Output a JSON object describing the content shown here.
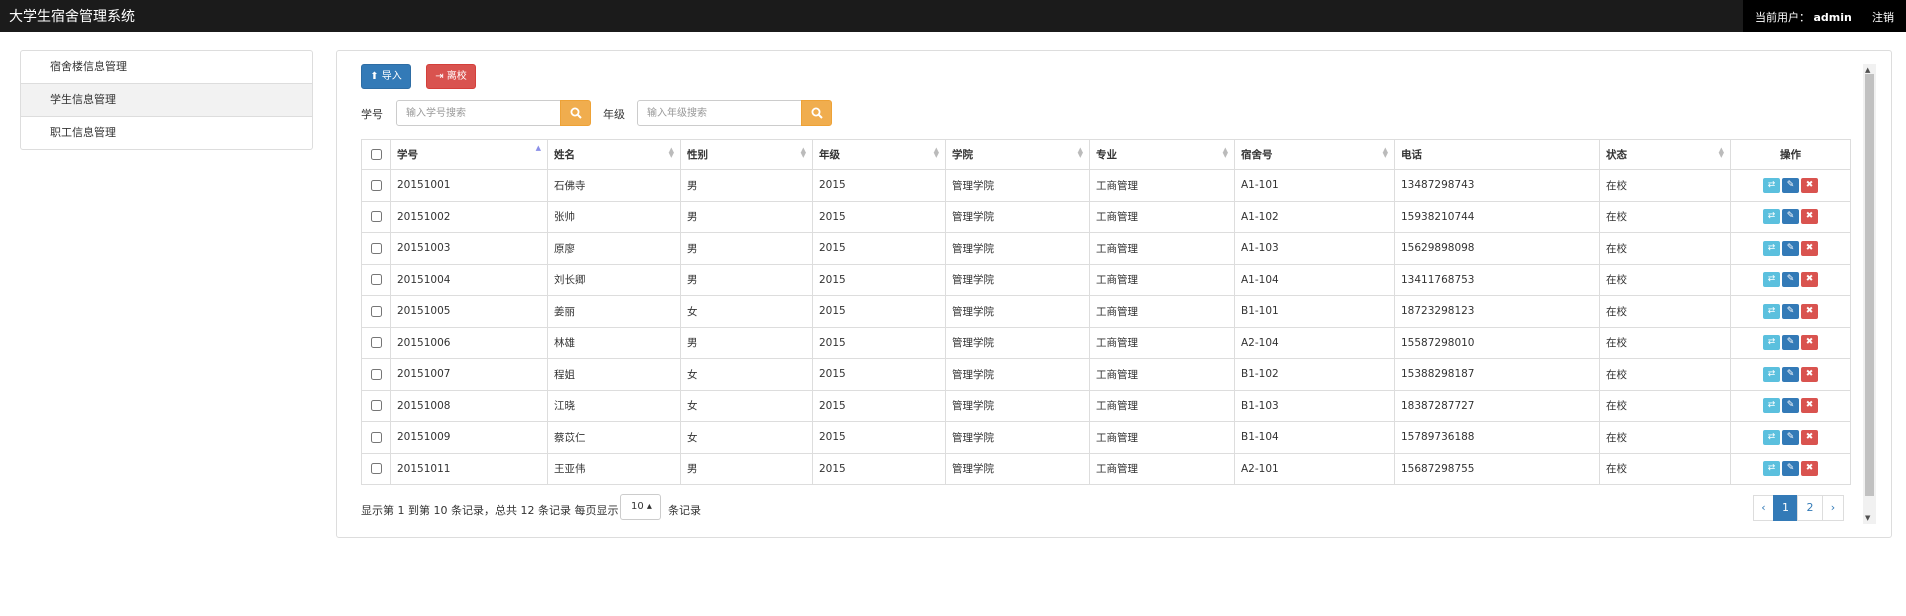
{
  "app": {
    "title": "大学生宿舍管理系统"
  },
  "user": {
    "current_label": "当前用户：",
    "name": "admin",
    "logout": "注销"
  },
  "sidebar": {
    "items": [
      {
        "label": "宿舍楼信息管理",
        "active": false
      },
      {
        "label": "学生信息管理",
        "active": true
      },
      {
        "label": "职工信息管理",
        "active": false
      }
    ]
  },
  "toolbar": {
    "import_label": "导入",
    "leave_label": "离校"
  },
  "search": {
    "id_label": "学号",
    "id_placeholder": "输入学号搜索",
    "grade_label": "年级",
    "grade_placeholder": "输入年级搜索"
  },
  "table": {
    "columns": [
      "学号",
      "姓名",
      "性别",
      "年级",
      "学院",
      "专业",
      "宿舍号",
      "电话",
      "状态",
      "操作"
    ],
    "rows": [
      [
        "20151001",
        "石佛寺",
        "男",
        "2015",
        "管理学院",
        "工商管理",
        "A1-101",
        "13487298743",
        "在校"
      ],
      [
        "20151002",
        "张帅",
        "男",
        "2015",
        "管理学院",
        "工商管理",
        "A1-102",
        "15938210744",
        "在校"
      ],
      [
        "20151003",
        "原廖",
        "男",
        "2015",
        "管理学院",
        "工商管理",
        "A1-103",
        "15629898098",
        "在校"
      ],
      [
        "20151004",
        "刘长卿",
        "男",
        "2015",
        "管理学院",
        "工商管理",
        "A1-104",
        "13411768753",
        "在校"
      ],
      [
        "20151005",
        "姜丽",
        "女",
        "2015",
        "管理学院",
        "工商管理",
        "B1-101",
        "18723298123",
        "在校"
      ],
      [
        "20151006",
        "林雄",
        "男",
        "2015",
        "管理学院",
        "工商管理",
        "A2-104",
        "15587298010",
        "在校"
      ],
      [
        "20151007",
        "程姐",
        "女",
        "2015",
        "管理学院",
        "工商管理",
        "B1-102",
        "15388298187",
        "在校"
      ],
      [
        "20151008",
        "江晓",
        "女",
        "2015",
        "管理学院",
        "工商管理",
        "B1-103",
        "18387287727",
        "在校"
      ],
      [
        "20151009",
        "蔡苡仁",
        "女",
        "2015",
        "管理学院",
        "工商管理",
        "B1-104",
        "15789736188",
        "在校"
      ],
      [
        "20151011",
        "王亚伟",
        "男",
        "2015",
        "管理学院",
        "工商管理",
        "A2-101",
        "15687298755",
        "在校"
      ]
    ]
  },
  "pagination": {
    "summary": "显示第 1 到第 10 条记录，总共 12 条记录 每页显示",
    "page_size": "10 ▴",
    "suffix": "条记录",
    "prev": "‹",
    "next": "›",
    "pages": [
      "1",
      "2"
    ],
    "current": "1"
  },
  "colors": {
    "primary": "#337ab7",
    "danger": "#d9534f",
    "warning": "#f0ad4e",
    "info": "#5bc0de"
  }
}
